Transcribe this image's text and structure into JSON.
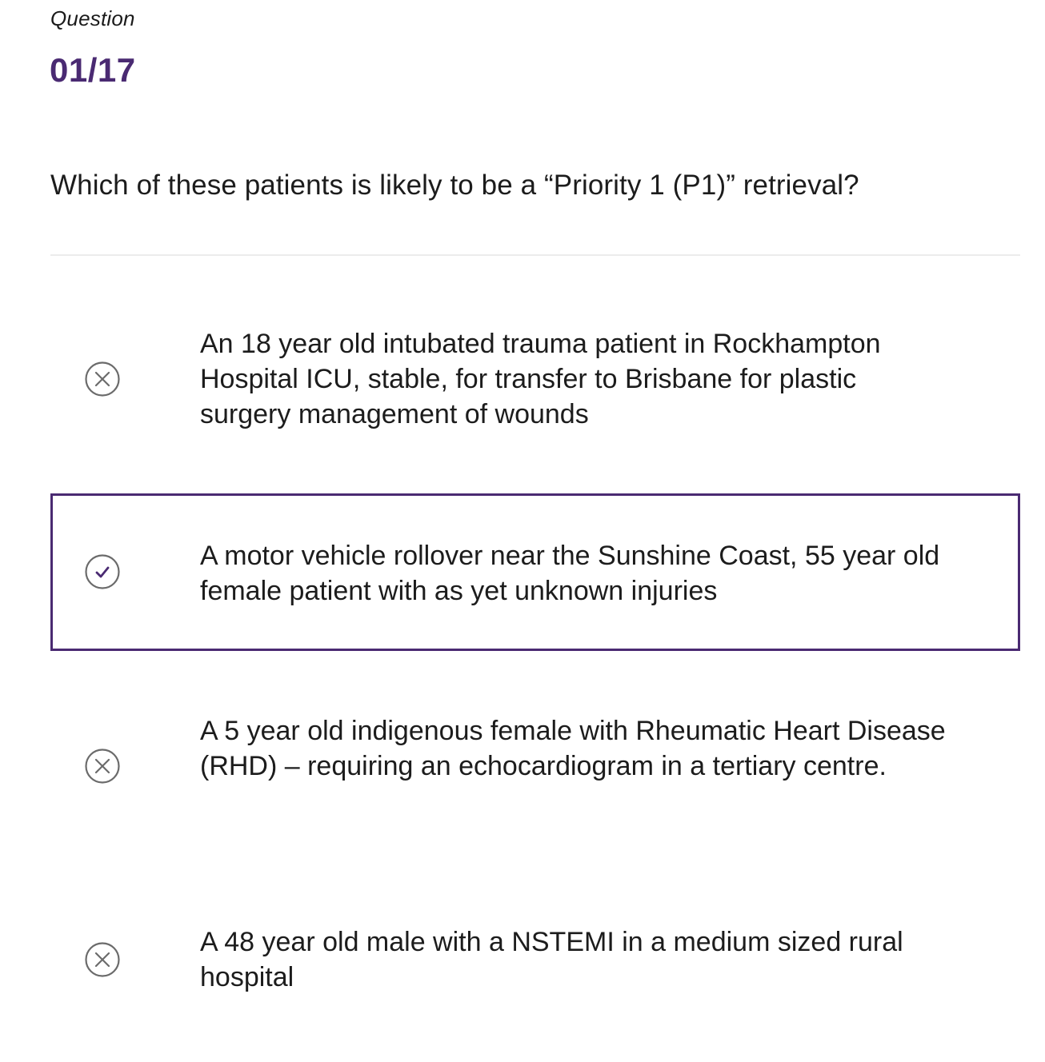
{
  "header": {
    "label": "Question",
    "number": "01/17"
  },
  "question": {
    "text": "Which of these patients is likely to be a “Priority 1 (P1)” retrieval?"
  },
  "answers": [
    {
      "text": "An 18 year old intubated trauma patient in Rockhampton Hospital ICU, stable, for transfer to Brisbane for plastic surgery management of wounds",
      "status_icon": "cross-icon",
      "selected": false
    },
    {
      "text": "A motor vehicle rollover near the Sunshine Coast, 55 year old female patient with as yet unknown injuries",
      "status_icon": "check-icon",
      "selected": true
    },
    {
      "text": "A 5 year old indigenous female with Rheumatic Heart Disease (RHD) – requiring an echocardiogram in a tertiary centre.",
      "status_icon": "cross-icon",
      "selected": false
    },
    {
      "text": "A 48 year old male with a NSTEMI in a medium sized rural hospital",
      "status_icon": "cross-icon",
      "selected": false
    }
  ],
  "colors": {
    "accent": "#4a2a72",
    "icon_stroke": "#6b6b6b",
    "check_mark": "#4a2a72",
    "divider": "#ececec"
  }
}
